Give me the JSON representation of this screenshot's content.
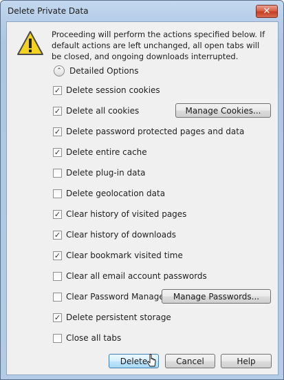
{
  "window": {
    "title": "Delete Private Data",
    "close_glyph": "✕"
  },
  "intro_text": "Proceeding will perform the actions specified below. If default actions are left unchanged, all open tabs will be closed, and ongoing downloads interrupted.",
  "details_toggle": {
    "label": "Detailed Options",
    "icon": "chevron-up-icon",
    "glyph": "⌃"
  },
  "options": [
    {
      "label": "Delete session cookies",
      "checked": true
    },
    {
      "label": "Delete all cookies",
      "checked": true
    },
    {
      "label": "Delete password protected pages and data",
      "checked": true
    },
    {
      "label": "Delete entire cache",
      "checked": true
    },
    {
      "label": "Delete plug-in data",
      "checked": false
    },
    {
      "label": "Delete geolocation data",
      "checked": false
    },
    {
      "label": "Clear history of visited pages",
      "checked": true
    },
    {
      "label": "Clear history of downloads",
      "checked": true
    },
    {
      "label": "Clear bookmark visited time",
      "checked": true
    },
    {
      "label": "Clear all email account passwords",
      "checked": false
    },
    {
      "label": "Clear Password Manager",
      "checked": false
    },
    {
      "label": "Delete persistent storage",
      "checked": true
    },
    {
      "label": "Close all tabs",
      "checked": false
    }
  ],
  "buttons": {
    "manage_cookies": "Manage Cookies...",
    "manage_passwords": "Manage Passwords...",
    "delete": "Delete",
    "cancel": "Cancel",
    "help": "Help"
  },
  "colors": {
    "accent": "#3c7fb1",
    "warning_yellow": "#f4d21f",
    "close_red": "#c43d24"
  }
}
